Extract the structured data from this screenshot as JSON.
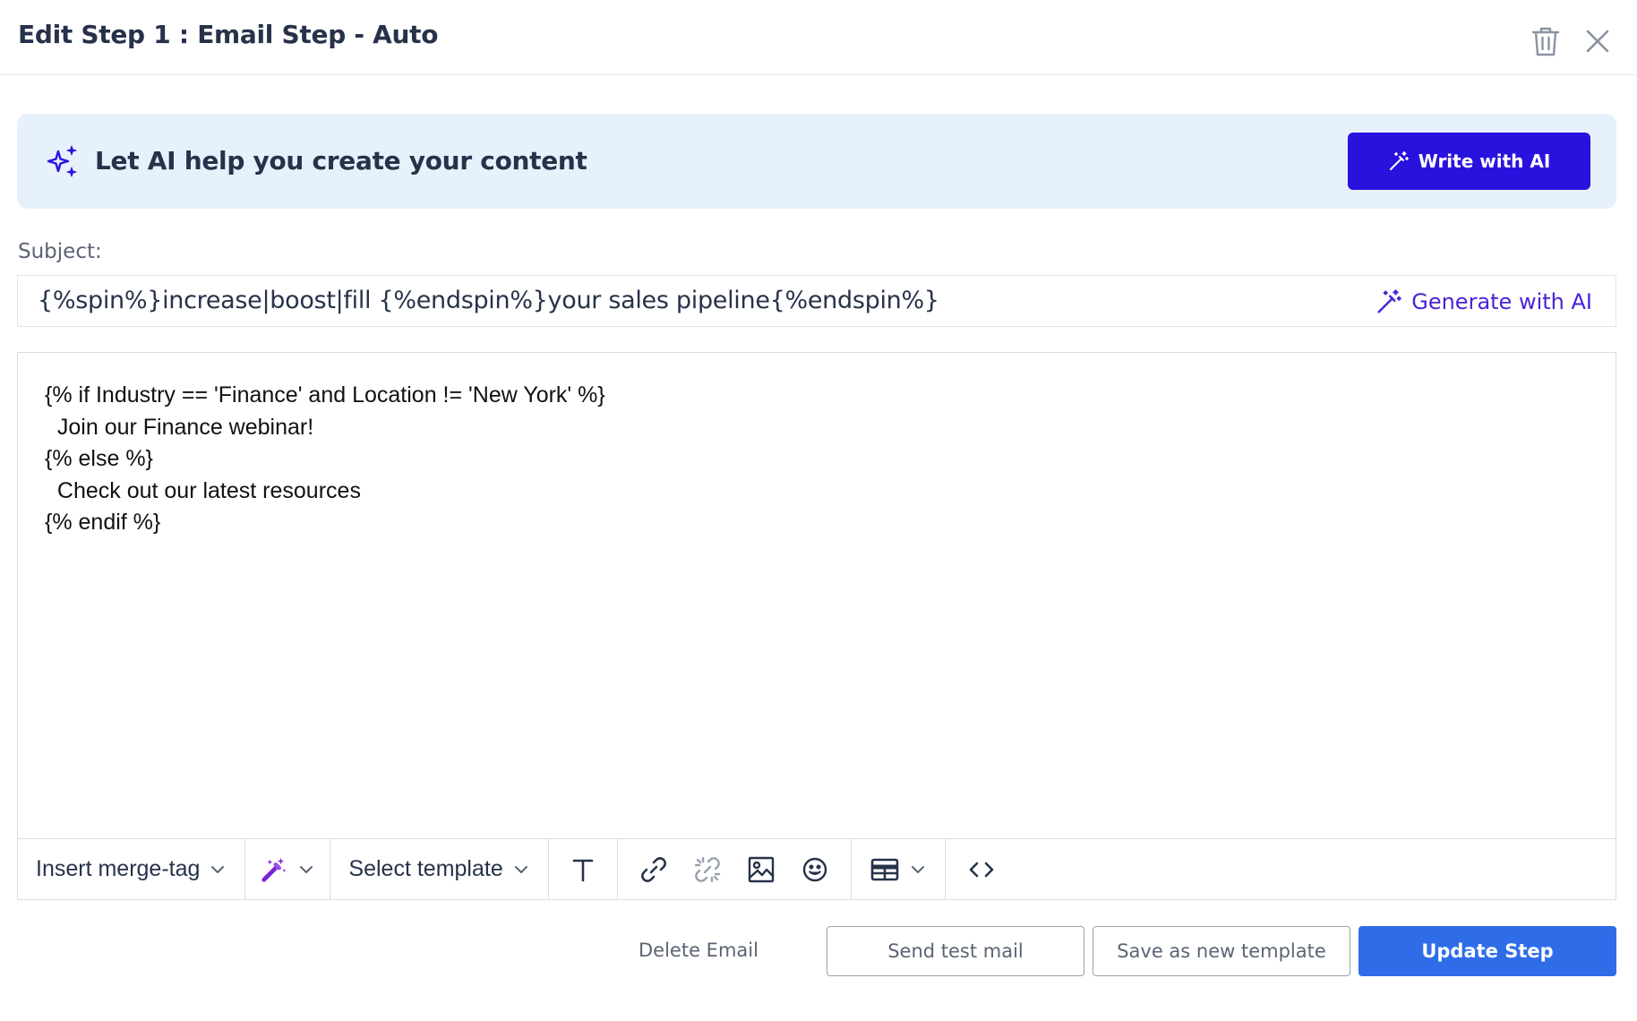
{
  "header": {
    "title": "Edit Step 1 : Email Step - Auto"
  },
  "ai_banner": {
    "text": "Let AI help you create your content",
    "button_label": "Write with AI"
  },
  "subject": {
    "label": "Subject:",
    "value": "{%spin%}increase|boost|fill {%endspin%}your sales pipeline{%endspin%}",
    "generate_label": "Generate with AI"
  },
  "editor": {
    "body": "{% if Industry == 'Finance' and Location != 'New York' %}\n  Join our Finance webinar!\n{% else %}\n  Check out our latest resources\n{% endif %}"
  },
  "toolbar": {
    "merge_tag_label": "Insert merge-tag",
    "template_label": "Select template"
  },
  "footer": {
    "delete_label": "Delete Email",
    "send_test_label": "Send test mail",
    "save_template_label": "Save as new template",
    "update_label": "Update Step"
  },
  "colors": {
    "accent": "#2a12de",
    "primary": "#2f6de8",
    "banner_bg": "#e7f1fc",
    "ai_purple": "#4a22d6"
  }
}
